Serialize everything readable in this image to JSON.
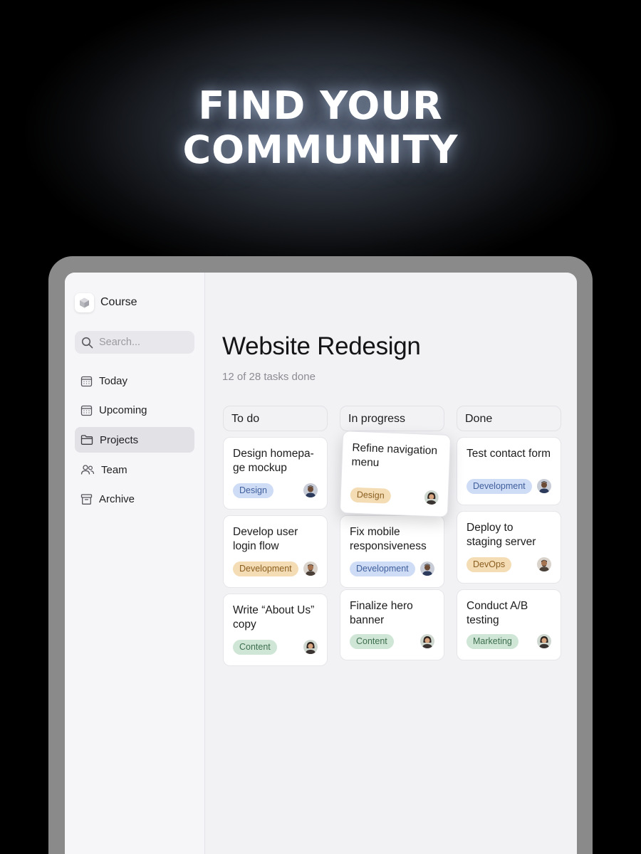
{
  "hero": {
    "line1": "FIND YOUR",
    "line2": "COMMUNITY"
  },
  "app": {
    "name": "Course"
  },
  "search": {
    "placeholder": "Search..."
  },
  "sidebar": {
    "items": [
      {
        "label": "Today",
        "icon": "calendar-icon"
      },
      {
        "label": "Upcoming",
        "icon": "calendar-icon"
      },
      {
        "label": "Projects",
        "icon": "folder-icon",
        "active": true
      },
      {
        "label": "Team",
        "icon": "people-icon"
      },
      {
        "label": "Archive",
        "icon": "archive-icon"
      }
    ]
  },
  "project": {
    "title": "Website Redesign",
    "progress": "12 of 28 tasks done"
  },
  "columns": [
    {
      "name": "To do",
      "cards": [
        {
          "title": "Design homepa-\nge mockup",
          "tag": "Design"
        },
        {
          "title": "Develop user login flow",
          "tag": "Development"
        },
        {
          "title": "Write “About Us” copy",
          "tag": "Content"
        }
      ]
    },
    {
      "name": "In progress",
      "cards": [
        {
          "title": "Refine navigation menu",
          "tag": "Design"
        },
        {
          "title": "Fix mobile responsiveness",
          "tag": "Development"
        },
        {
          "title": "Finalize hero banner",
          "tag": "Content"
        }
      ]
    },
    {
      "name": "Done",
      "cards": [
        {
          "title": "Test contact form",
          "tag": "Development"
        },
        {
          "title": "Deploy to staging server",
          "tag": "DevOps"
        },
        {
          "title": "Conduct A/B testing",
          "tag": "Marketing"
        }
      ]
    }
  ],
  "tag_colors": {
    "Design": {
      "bg": "#cfdcf6",
      "fg": "#3f5f9c"
    },
    "Development": {
      "bg": "#cfdcf6",
      "fg": "#3f5f9c"
    },
    "Content": {
      "bg": "#cfe6d6",
      "fg": "#3d6e4e"
    },
    "DevOps": {
      "bg": "#f4dcb5",
      "fg": "#8a5e1f"
    },
    "Marketing": {
      "bg": "#cfe6d6",
      "fg": "#3d6e4e"
    },
    "Design-lifted": {
      "bg": "#f4dcb5",
      "fg": "#8a5e1f"
    }
  }
}
